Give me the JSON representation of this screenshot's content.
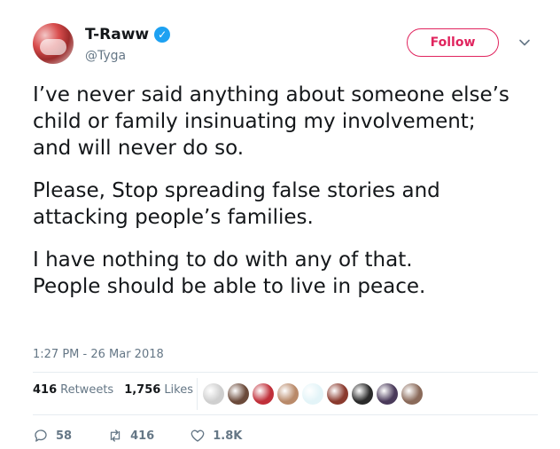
{
  "user": {
    "display_name": "T-Raww",
    "handle": "@Tyga",
    "verified_mark": "✓",
    "follow_label": "Follow"
  },
  "tweet": {
    "paragraphs": [
      "I’ve never said anything about someone else’s\nchild or family insinuating my involvement;\nand will never do so.",
      "Please, Stop spreading false stories and\nattacking people’s families.",
      "I have nothing to do with any of that.\nPeople should be able to live in peace."
    ],
    "timestamp": "1:27 PM - 26 Mar 2018"
  },
  "stats": {
    "retweets_count": "416",
    "retweets_label": "Retweets",
    "likes_count": "1,756",
    "likes_label": "Likes"
  },
  "liker_colors": [
    "#cfcfcf",
    "#6b4a3a",
    "#c0303a",
    "#b98a6a",
    "#e3f4f8",
    "#8a3a2e",
    "#2a2a2a",
    "#4a3a5a",
    "#8a6a5a"
  ],
  "actions": {
    "replies": "58",
    "retweets": "416",
    "likes": "1.8K"
  },
  "colors": {
    "accent": "#1da1f2",
    "follow": "#e0245e",
    "muted": "#657786"
  },
  "icons": {
    "verified": "verified-badge-icon",
    "chevron": "chevron-down-icon",
    "reply": "reply-icon",
    "retweet": "retweet-icon",
    "like": "heart-icon"
  }
}
